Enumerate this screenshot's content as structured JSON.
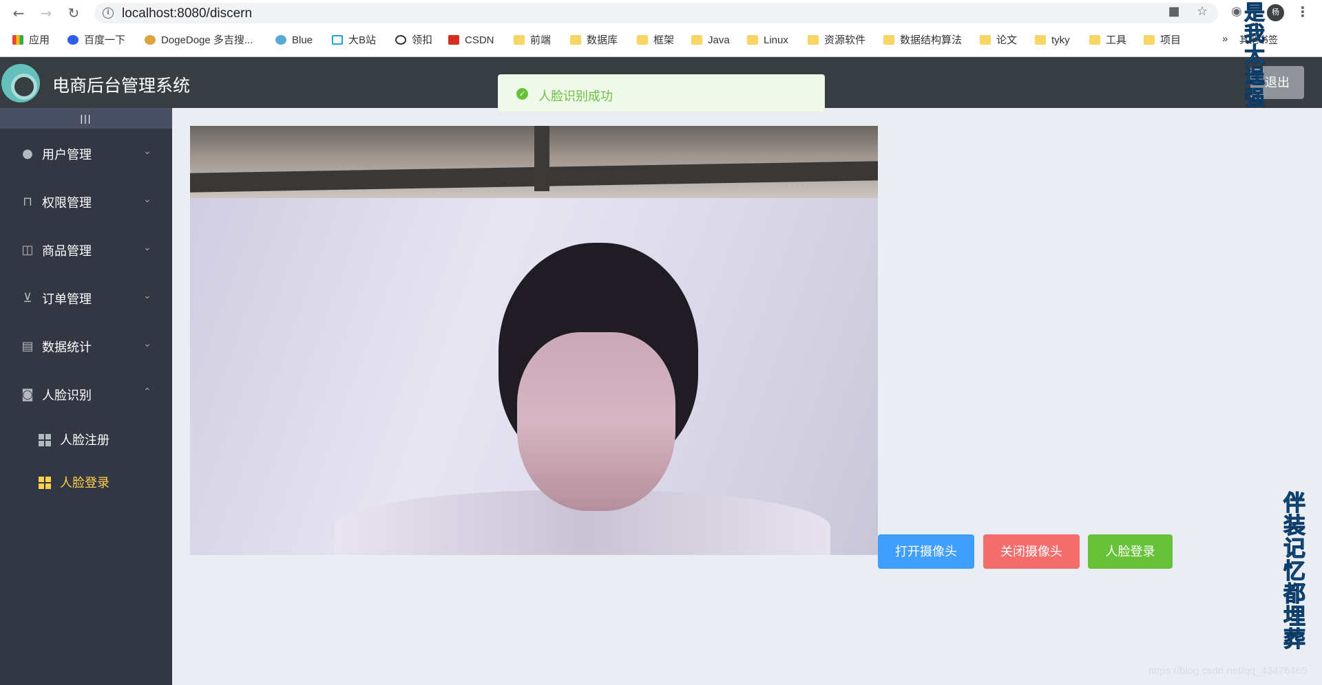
{
  "browser": {
    "url": "localhost:8080/discern",
    "profile_initial": "杨",
    "bookmarks": [
      {
        "label": "应用",
        "icon": "apps-grid-icon"
      },
      {
        "label": "百度一下",
        "icon": "baidu-paw-icon"
      },
      {
        "label": "DogeDoge 多吉搜...",
        "icon": "doge-icon"
      },
      {
        "label": "Blue",
        "icon": "blue-swirl-icon"
      },
      {
        "label": "大B站",
        "icon": "bilibili-tv-icon"
      },
      {
        "label": "领扣",
        "icon": "leetcode-icon"
      },
      {
        "label": "CSDN",
        "icon": "csdn-icon"
      },
      {
        "label": "前端",
        "icon": "folder-icon"
      },
      {
        "label": "数据库",
        "icon": "folder-icon"
      },
      {
        "label": "框架",
        "icon": "folder-icon"
      },
      {
        "label": "Java",
        "icon": "folder-icon"
      },
      {
        "label": "Linux",
        "icon": "folder-icon"
      },
      {
        "label": "资源软件",
        "icon": "folder-icon"
      },
      {
        "label": "数据结构算法",
        "icon": "folder-icon"
      },
      {
        "label": "论文",
        "icon": "folder-icon"
      },
      {
        "label": "tyky",
        "icon": "folder-icon"
      },
      {
        "label": "工具",
        "icon": "folder-icon"
      },
      {
        "label": "项目",
        "icon": "folder-icon"
      }
    ],
    "more_label": "»",
    "other_bookmarks": "其他书签"
  },
  "header": {
    "title": "电商后台管理系统",
    "logout_label": "退出"
  },
  "sidebar": {
    "toggle_label": "|||",
    "menus": [
      {
        "label": "用户管理",
        "icon": "user-icon",
        "expanded": false
      },
      {
        "label": "权限管理",
        "icon": "lock-icon",
        "expanded": false
      },
      {
        "label": "商品管理",
        "icon": "bag-icon",
        "expanded": false
      },
      {
        "label": "订单管理",
        "icon": "cart-icon",
        "expanded": false
      },
      {
        "label": "数据统计",
        "icon": "document-icon",
        "expanded": false
      },
      {
        "label": "人脸识别",
        "icon": "camera-icon",
        "expanded": true
      }
    ],
    "submenu": [
      {
        "label": "人脸注册",
        "icon": "grid-icon",
        "active": false
      },
      {
        "label": "人脸登录",
        "icon": "grid-icon",
        "active": true
      }
    ]
  },
  "toast": {
    "message": "人脸识别成功",
    "type": "success",
    "color": "#67c23a"
  },
  "actions": {
    "open_camera": "打开摄像头",
    "close_camera": "关闭摄像头",
    "face_login": "人脸登录"
  },
  "overlay": {
    "text_top": "是我太逞强",
    "text_bottom": "伴装记忆都埋葬",
    "watermark": "https://blog.csdn.net/qq_43476465"
  },
  "colors": {
    "header_bg": "#373d41",
    "sidebar_bg": "#333744",
    "active_menu": "#ffd04b",
    "primary": "#409eff",
    "danger": "#f56c6c",
    "success": "#67c23a"
  }
}
